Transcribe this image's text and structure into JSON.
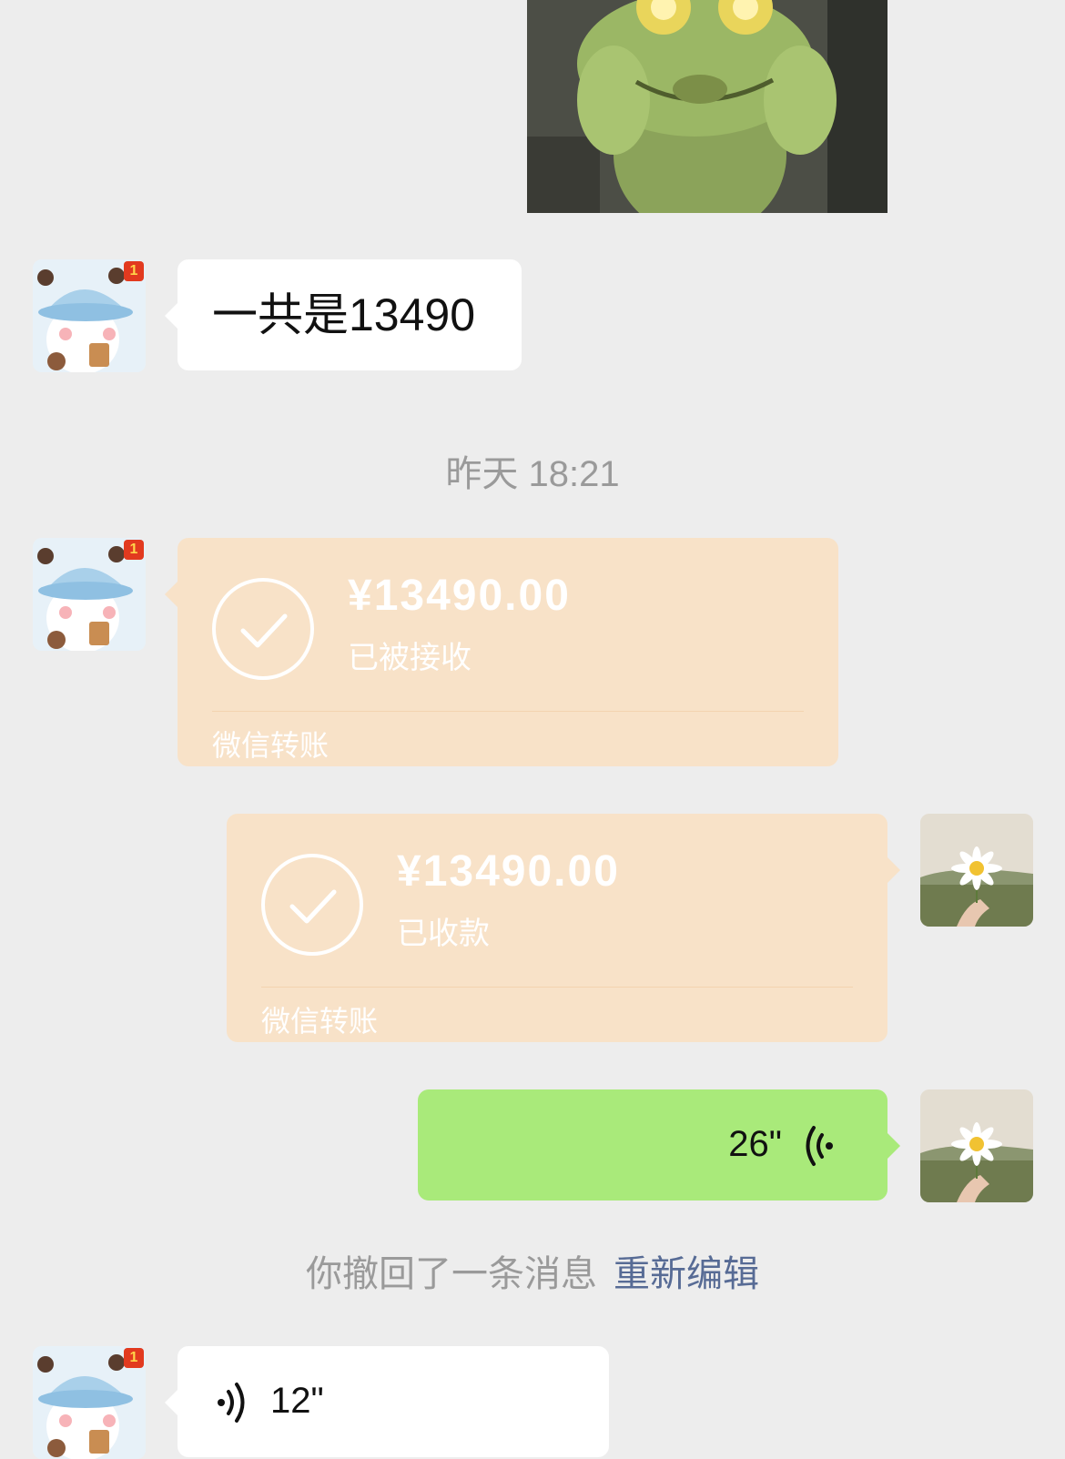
{
  "chat": {
    "top_image": {
      "subject": "frog figurine photo"
    },
    "messages": [
      {
        "sender": "contact",
        "avatar": "panda-avatar",
        "badge": "1",
        "text": "一共是13490"
      },
      {
        "timestamp": "昨天 18:21"
      },
      {
        "sender": "contact",
        "avatar": "panda-avatar",
        "badge": "1",
        "type": "transfer",
        "amount": "¥13490.00",
        "status": "已被接收",
        "footer": "微信转账"
      },
      {
        "sender": "me",
        "avatar": "daisy-avatar",
        "type": "transfer",
        "amount": "¥13490.00",
        "status": "已收款",
        "footer": "微信转账"
      },
      {
        "sender": "me",
        "avatar": "daisy-avatar",
        "type": "voice",
        "duration": "26\""
      },
      {
        "system": "你撤回了一条消息",
        "action": "重新编辑"
      },
      {
        "sender": "contact",
        "avatar": "panda-avatar",
        "badge": "1",
        "type": "voice",
        "duration": "12\""
      }
    ]
  },
  "colors": {
    "background": "#ededed",
    "incoming_bubble": "#ffffff",
    "outgoing_bubble": "#a9ea7a",
    "transfer_bubble": "#f8e2c8",
    "link": "#576b95"
  }
}
